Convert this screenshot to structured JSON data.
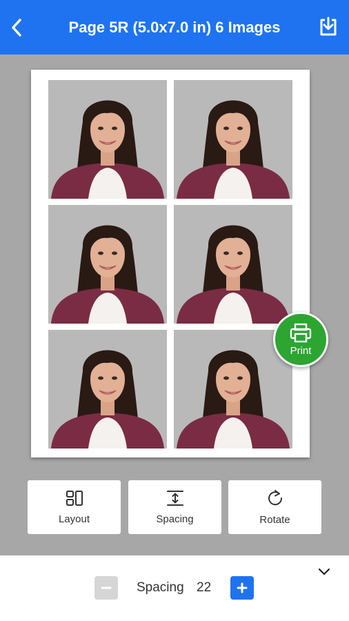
{
  "header": {
    "title": "Page 5R (5.0x7.0 in) 6 Images",
    "back_icon": "back-arrow-icon",
    "download_icon": "download-icon"
  },
  "sheet": {
    "photo_count": 6,
    "columns": 2,
    "rows": 3
  },
  "print_button": {
    "label": "Print",
    "color": "#2ca531",
    "icon": "print-icon"
  },
  "tools": [
    {
      "label": "Layout",
      "icon": "layout-icon"
    },
    {
      "label": "Spacing",
      "icon": "spacing-icon"
    },
    {
      "label": "Rotate",
      "icon": "rotate-icon"
    }
  ],
  "spacing_control": {
    "label": "Spacing",
    "value": "22",
    "minus_icon": "minus-icon",
    "plus_icon": "plus-icon",
    "collapse_icon": "chevron-down-icon"
  },
  "colors": {
    "accent": "#1f73f0",
    "print": "#2ca531",
    "background": "#a7a7a7"
  }
}
